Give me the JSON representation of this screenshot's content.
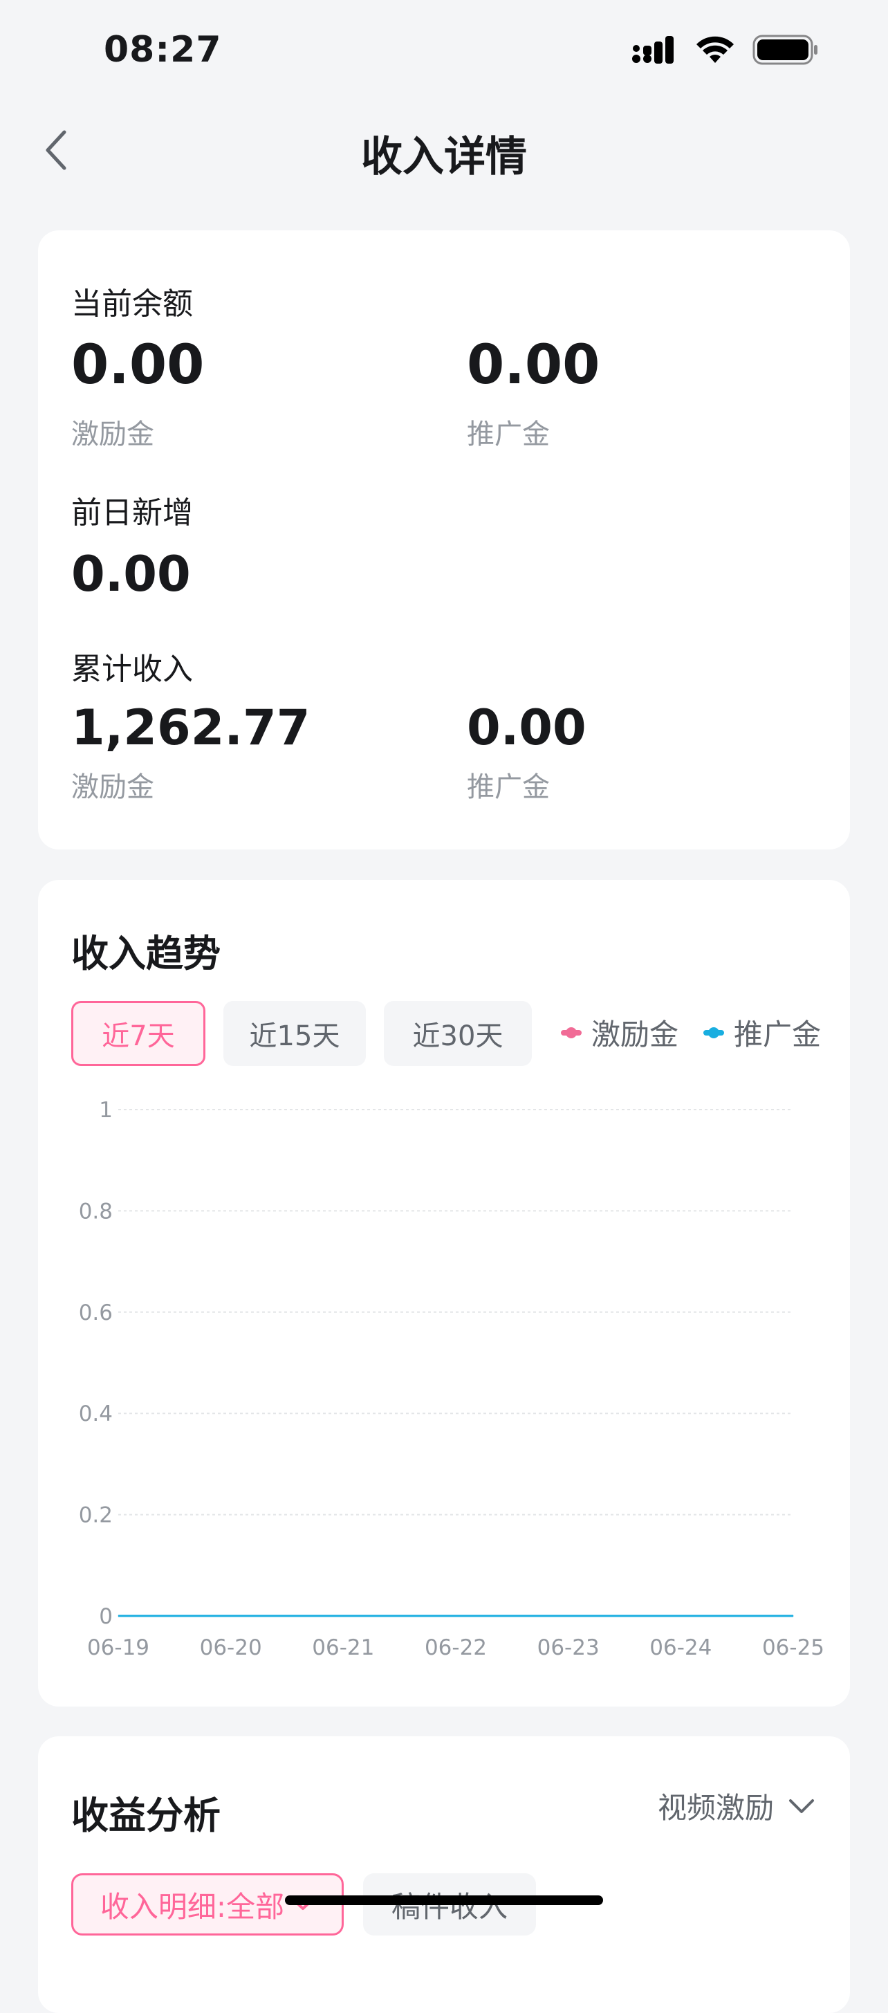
{
  "status_bar": {
    "time": "08:27"
  },
  "header": {
    "title": "收入详情"
  },
  "balance_card": {
    "current_balance_label": "当前余额",
    "current_incentive_value": "0.00",
    "current_incentive_label": "激励金",
    "current_promo_value": "0.00",
    "current_promo_label": "推广金",
    "prev_day_label": "前日新增",
    "prev_day_value": "0.00",
    "cumulative_label": "累计收入",
    "cumulative_incentive_value": "1,262.77",
    "cumulative_incentive_label": "激励金",
    "cumulative_promo_value": "0.00",
    "cumulative_promo_label": "推广金"
  },
  "trend_card": {
    "title": "收入趋势",
    "ranges": [
      {
        "label": "近7天",
        "active": true
      },
      {
        "label": "近15天",
        "active": false
      },
      {
        "label": "近30天",
        "active": false
      }
    ],
    "legend": [
      {
        "label": "激励金",
        "color": "#f16b96"
      },
      {
        "label": "推广金",
        "color": "#19aee0"
      }
    ]
  },
  "chart_data": {
    "type": "line",
    "x": [
      "06-19",
      "06-20",
      "06-21",
      "06-22",
      "06-23",
      "06-24",
      "06-25"
    ],
    "y_ticks": [
      "1",
      "0.8",
      "0.6",
      "0.4",
      "0.2",
      "0"
    ],
    "ylim": [
      0,
      1
    ],
    "grid": true,
    "legend_position": "top-right",
    "series": [
      {
        "name": "激励金",
        "color": "#f16b96",
        "values": [
          0,
          0,
          0,
          0,
          0,
          0,
          0
        ]
      },
      {
        "name": "推广金",
        "color": "#19aee0",
        "values": [
          0,
          0,
          0,
          0,
          0,
          0,
          0
        ]
      }
    ]
  },
  "analysis_card": {
    "title": "收益分析",
    "dropdown_label": "视频激励",
    "pills": [
      {
        "label": "收入明细:全部",
        "active": true
      },
      {
        "label": "稿件收入",
        "active": false
      }
    ]
  }
}
